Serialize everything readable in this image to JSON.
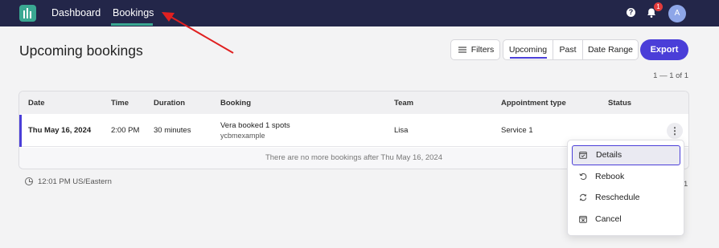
{
  "nav": {
    "items": [
      {
        "label": "Dashboard"
      },
      {
        "label": "Bookings"
      }
    ],
    "notification_count": "1",
    "avatar_initial": "A",
    "help_glyph": "?",
    "accent_color": "#3aa892",
    "background_color": "#232649"
  },
  "header": {
    "title": "Upcoming bookings",
    "filters_label": "Filters",
    "segments": [
      "Upcoming",
      "Past",
      "Date Range"
    ],
    "selected_segment": "Upcoming",
    "export_label": "Export",
    "pager": "1 — 1 of 1"
  },
  "table": {
    "columns": [
      "Date",
      "Time",
      "Duration",
      "Booking",
      "Team",
      "Appointment type",
      "Status"
    ],
    "rows": [
      {
        "date": "Thu May 16, 2024",
        "time": "2:00 PM",
        "duration": "30 minutes",
        "booking": "Vera booked 1 spots",
        "booking_sub": "ycbmexample",
        "team": "Lisa",
        "appointment_type": "Service 1",
        "status": "",
        "actions_glyph": "⋮"
      }
    ],
    "footer_note": "There are no more bookings after Thu May 16, 2024"
  },
  "timezone": "12:01 PM US/Eastern",
  "stray_text": "1",
  "menu": {
    "items": [
      {
        "label": "Details",
        "icon": "calendar-check-icon",
        "selected": true
      },
      {
        "label": "Rebook",
        "icon": "rebook-icon",
        "selected": false
      },
      {
        "label": "Reschedule",
        "icon": "refresh-icon",
        "selected": false
      },
      {
        "label": "Cancel",
        "icon": "calendar-x-icon",
        "selected": false
      }
    ]
  },
  "colors": {
    "primary": "#4a3ed8",
    "annotation_arrow": "#e02020"
  }
}
